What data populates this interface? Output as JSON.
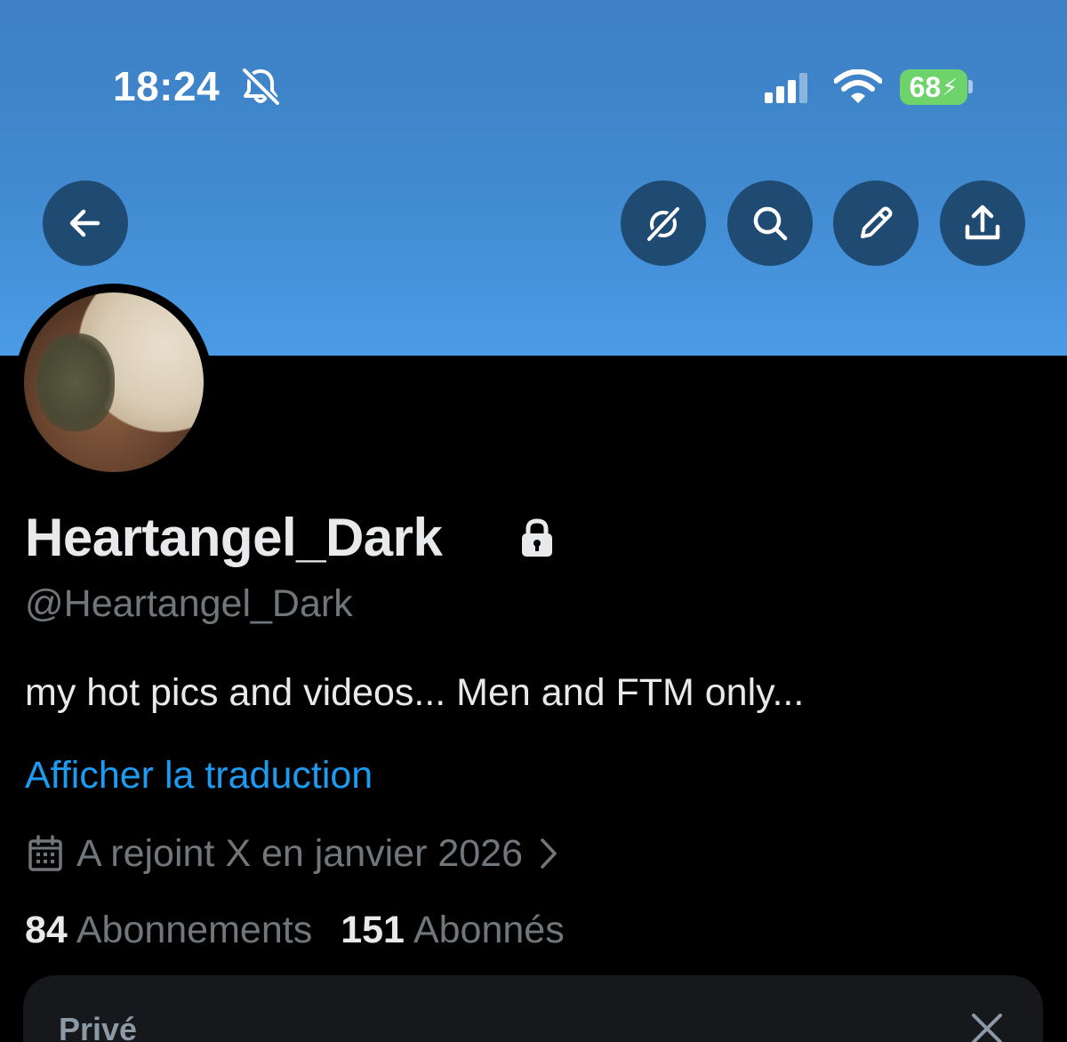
{
  "status_bar": {
    "time": "18:24",
    "battery_level": "68",
    "battery_color": "#6ed36b"
  },
  "header": {
    "banner_color": "#4189cf",
    "buttons": [
      {
        "name": "back",
        "icon": "arrow-left-icon"
      },
      {
        "name": "grok",
        "icon": "grok-icon"
      },
      {
        "name": "search",
        "icon": "search-icon"
      },
      {
        "name": "edit",
        "icon": "pencil-icon"
      },
      {
        "name": "share",
        "icon": "share-icon"
      }
    ]
  },
  "profile": {
    "display_name": "Heartangel_Dark",
    "protected": true,
    "handle": "@Heartangel_Dark",
    "bio": "my hot pics and videos... Men and FTM only...",
    "translate_link": "Afficher la traduction",
    "joined": "A rejoint X en janvier 2026",
    "following_count": "84",
    "following_label": "Abonnements",
    "followers_count": "151",
    "followers_label": "Abonnés"
  },
  "private_card": {
    "title": "Privé"
  },
  "colors": {
    "background": "#000000",
    "text_primary": "#e7e9ea",
    "text_secondary": "#71767b",
    "link": "#1d9bf0",
    "button_bg": "#1f4b73"
  }
}
